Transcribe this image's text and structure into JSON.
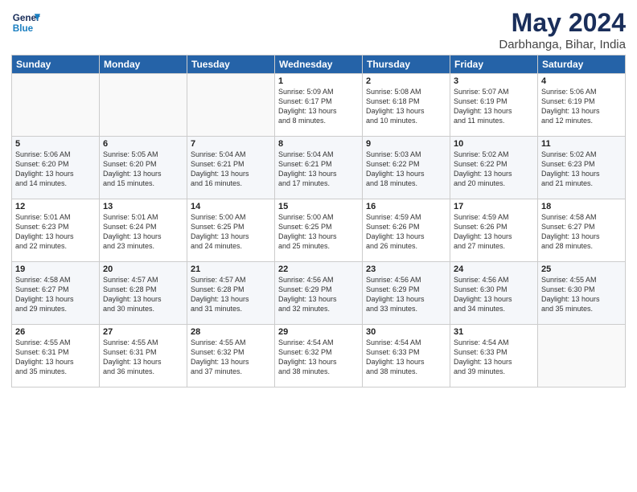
{
  "header": {
    "logo_line1": "General",
    "logo_line2": "Blue",
    "title": "May 2024",
    "subtitle": "Darbhanga, Bihar, India"
  },
  "weekdays": [
    "Sunday",
    "Monday",
    "Tuesday",
    "Wednesday",
    "Thursday",
    "Friday",
    "Saturday"
  ],
  "weeks": [
    [
      {
        "day": "",
        "info": ""
      },
      {
        "day": "",
        "info": ""
      },
      {
        "day": "",
        "info": ""
      },
      {
        "day": "1",
        "info": "Sunrise: 5:09 AM\nSunset: 6:17 PM\nDaylight: 13 hours\nand 8 minutes."
      },
      {
        "day": "2",
        "info": "Sunrise: 5:08 AM\nSunset: 6:18 PM\nDaylight: 13 hours\nand 10 minutes."
      },
      {
        "day": "3",
        "info": "Sunrise: 5:07 AM\nSunset: 6:19 PM\nDaylight: 13 hours\nand 11 minutes."
      },
      {
        "day": "4",
        "info": "Sunrise: 5:06 AM\nSunset: 6:19 PM\nDaylight: 13 hours\nand 12 minutes."
      }
    ],
    [
      {
        "day": "5",
        "info": "Sunrise: 5:06 AM\nSunset: 6:20 PM\nDaylight: 13 hours\nand 14 minutes."
      },
      {
        "day": "6",
        "info": "Sunrise: 5:05 AM\nSunset: 6:20 PM\nDaylight: 13 hours\nand 15 minutes."
      },
      {
        "day": "7",
        "info": "Sunrise: 5:04 AM\nSunset: 6:21 PM\nDaylight: 13 hours\nand 16 minutes."
      },
      {
        "day": "8",
        "info": "Sunrise: 5:04 AM\nSunset: 6:21 PM\nDaylight: 13 hours\nand 17 minutes."
      },
      {
        "day": "9",
        "info": "Sunrise: 5:03 AM\nSunset: 6:22 PM\nDaylight: 13 hours\nand 18 minutes."
      },
      {
        "day": "10",
        "info": "Sunrise: 5:02 AM\nSunset: 6:22 PM\nDaylight: 13 hours\nand 20 minutes."
      },
      {
        "day": "11",
        "info": "Sunrise: 5:02 AM\nSunset: 6:23 PM\nDaylight: 13 hours\nand 21 minutes."
      }
    ],
    [
      {
        "day": "12",
        "info": "Sunrise: 5:01 AM\nSunset: 6:23 PM\nDaylight: 13 hours\nand 22 minutes."
      },
      {
        "day": "13",
        "info": "Sunrise: 5:01 AM\nSunset: 6:24 PM\nDaylight: 13 hours\nand 23 minutes."
      },
      {
        "day": "14",
        "info": "Sunrise: 5:00 AM\nSunset: 6:25 PM\nDaylight: 13 hours\nand 24 minutes."
      },
      {
        "day": "15",
        "info": "Sunrise: 5:00 AM\nSunset: 6:25 PM\nDaylight: 13 hours\nand 25 minutes."
      },
      {
        "day": "16",
        "info": "Sunrise: 4:59 AM\nSunset: 6:26 PM\nDaylight: 13 hours\nand 26 minutes."
      },
      {
        "day": "17",
        "info": "Sunrise: 4:59 AM\nSunset: 6:26 PM\nDaylight: 13 hours\nand 27 minutes."
      },
      {
        "day": "18",
        "info": "Sunrise: 4:58 AM\nSunset: 6:27 PM\nDaylight: 13 hours\nand 28 minutes."
      }
    ],
    [
      {
        "day": "19",
        "info": "Sunrise: 4:58 AM\nSunset: 6:27 PM\nDaylight: 13 hours\nand 29 minutes."
      },
      {
        "day": "20",
        "info": "Sunrise: 4:57 AM\nSunset: 6:28 PM\nDaylight: 13 hours\nand 30 minutes."
      },
      {
        "day": "21",
        "info": "Sunrise: 4:57 AM\nSunset: 6:28 PM\nDaylight: 13 hours\nand 31 minutes."
      },
      {
        "day": "22",
        "info": "Sunrise: 4:56 AM\nSunset: 6:29 PM\nDaylight: 13 hours\nand 32 minutes."
      },
      {
        "day": "23",
        "info": "Sunrise: 4:56 AM\nSunset: 6:29 PM\nDaylight: 13 hours\nand 33 minutes."
      },
      {
        "day": "24",
        "info": "Sunrise: 4:56 AM\nSunset: 6:30 PM\nDaylight: 13 hours\nand 34 minutes."
      },
      {
        "day": "25",
        "info": "Sunrise: 4:55 AM\nSunset: 6:30 PM\nDaylight: 13 hours\nand 35 minutes."
      }
    ],
    [
      {
        "day": "26",
        "info": "Sunrise: 4:55 AM\nSunset: 6:31 PM\nDaylight: 13 hours\nand 35 minutes."
      },
      {
        "day": "27",
        "info": "Sunrise: 4:55 AM\nSunset: 6:31 PM\nDaylight: 13 hours\nand 36 minutes."
      },
      {
        "day": "28",
        "info": "Sunrise: 4:55 AM\nSunset: 6:32 PM\nDaylight: 13 hours\nand 37 minutes."
      },
      {
        "day": "29",
        "info": "Sunrise: 4:54 AM\nSunset: 6:32 PM\nDaylight: 13 hours\nand 38 minutes."
      },
      {
        "day": "30",
        "info": "Sunrise: 4:54 AM\nSunset: 6:33 PM\nDaylight: 13 hours\nand 38 minutes."
      },
      {
        "day": "31",
        "info": "Sunrise: 4:54 AM\nSunset: 6:33 PM\nDaylight: 13 hours\nand 39 minutes."
      },
      {
        "day": "",
        "info": ""
      }
    ]
  ]
}
